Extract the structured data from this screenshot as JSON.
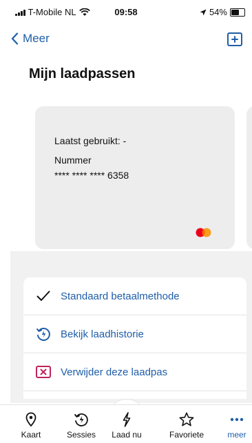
{
  "status_bar": {
    "carrier": "T-Mobile NL",
    "time": "09:58",
    "battery": "54%",
    "battery_level": 0.54
  },
  "nav": {
    "back_label": "Meer",
    "add_icon": "plus-square-icon"
  },
  "page": {
    "title": "Mijn laadpassen"
  },
  "card": {
    "last_used": "Laatst gebruikt: -",
    "number_label": "Nummer",
    "number": "**** **** **** 6358",
    "brand_icon": "mastercard-icon"
  },
  "menu": {
    "items": [
      {
        "label": "Standaard betaalmethode",
        "icon": "checkmark-icon"
      },
      {
        "label": "Bekijk laadhistorie",
        "icon": "history-icon"
      },
      {
        "label": "Verwijder deze laadpas",
        "icon": "remove-icon"
      }
    ]
  },
  "tabbar": {
    "tabs": [
      {
        "label": "Kaart",
        "icon": "location-pin-icon"
      },
      {
        "label": "Sessies",
        "icon": "sessions-icon"
      },
      {
        "label": "Laad nu",
        "icon": "lightning-icon"
      },
      {
        "label": "Favoriete",
        "icon": "star-icon"
      },
      {
        "label": "meer",
        "icon": "more-icon"
      }
    ]
  },
  "colors": {
    "accent": "#1f5ea8",
    "card_bg": "#ededed",
    "danger": "#c0225c"
  }
}
